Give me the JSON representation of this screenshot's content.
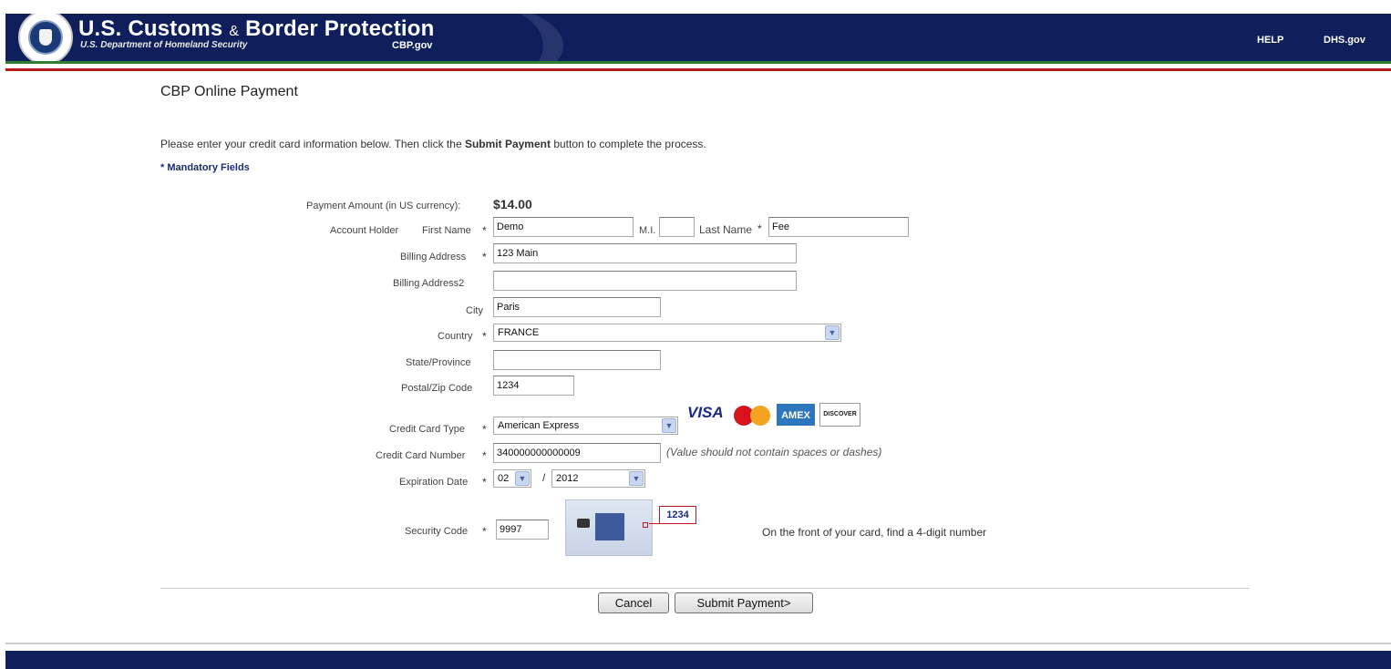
{
  "header": {
    "brand_title_part1": "U.S. Customs",
    "brand_amp": "&",
    "brand_title_part2": "Border Protection",
    "brand_subtitle": "U.S. Department of Homeland Security",
    "brand_domain": "CBP.gov",
    "links": {
      "help": "HELP",
      "dhs": "DHS.gov"
    },
    "colors": {
      "bar": "#0e1f5b",
      "green_stripe": "#2f7d32",
      "red_stripe": "#b8181c"
    }
  },
  "page": {
    "title": "CBP Online Payment",
    "instructions_before": "Please enter your credit card information below. Then click the ",
    "instructions_bold": "Submit Payment",
    "instructions_after": " button to complete the process.",
    "mandatory_note": "* Mandatory Fields"
  },
  "form": {
    "required_marker": "*",
    "payment_amount_label": "Payment Amount (in US currency):",
    "payment_amount_value": "$14.00",
    "account_holder_label": "Account Holder",
    "first_name_label": "First Name",
    "first_name_value": "Demo",
    "mi_label": "M.I.",
    "mi_value": "",
    "last_name_label": "Last Name",
    "last_name_value": "Fee",
    "billing_address_label": "Billing Address",
    "billing_address_value": "123 Main",
    "billing_address2_label": "Billing Address2",
    "billing_address2_value": "",
    "city_label": "City",
    "city_value": "Paris",
    "country_label": "Country",
    "country_value": "FRANCE",
    "state_label": "State/Province",
    "state_value": "",
    "postal_label": "Postal/Zip Code",
    "postal_value": "1234",
    "card_type_label": "Credit Card Type",
    "card_type_value": "American Express",
    "card_logos": {
      "visa": "VISA",
      "amex": "AMEX",
      "discover": "DISCOVER",
      "mastercard_icon": "mastercard-logo"
    },
    "card_number_label": "Credit Card Number",
    "card_number_value": "340000000000009",
    "card_number_hint": "(Value should not contain spaces or dashes)",
    "expiration_label": "Expiration Date",
    "exp_month_value": "02",
    "exp_separator": "/",
    "exp_year_value": "2012",
    "security_code_label": "Security Code",
    "security_code_value": "9997",
    "security_code_sample": "1234",
    "security_code_hint": "On the front of your card, find a 4-digit number"
  },
  "buttons": {
    "cancel": "Cancel",
    "submit": "Submit Payment>"
  },
  "icons": {
    "select_arrow": "chevron-down-icon",
    "seal": "dhs-seal-icon"
  }
}
